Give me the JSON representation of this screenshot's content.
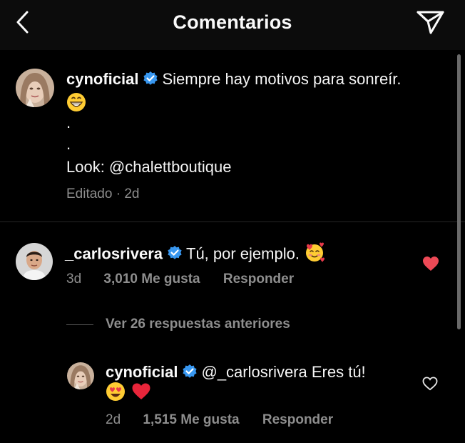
{
  "header": {
    "title": "Comentarios",
    "back_icon": "chevron-left-icon",
    "send_icon": "direct-send-icon"
  },
  "caption": {
    "username": "cynoficial",
    "text": "Siempre hay motivos para sonreír.",
    "emoji": "😁",
    "dot1": ".",
    "dot2": ".",
    "look": "Look: @chalettboutique",
    "edited": "Editado · 2d"
  },
  "comment": {
    "username": "_carlosrivera",
    "text": "Tú, por ejemplo.",
    "emoji": "🥰",
    "time": "3d",
    "likes": "3,010 Me gusta",
    "reply": "Responder",
    "liked": true
  },
  "view_replies": "Ver 26 respuestas anteriores",
  "reply": {
    "username": "cynoficial",
    "text": "@_carlosrivera Eres tú!",
    "emojis": "😍❤️",
    "time": "2d",
    "likes": "1,515 Me gusta",
    "reply": "Responder",
    "liked": false
  },
  "colors": {
    "background": "#000000",
    "header": "#0c0c0c",
    "muted": "#8e8e8e",
    "verified": "#3897f0",
    "like_red": "#ed4956"
  }
}
